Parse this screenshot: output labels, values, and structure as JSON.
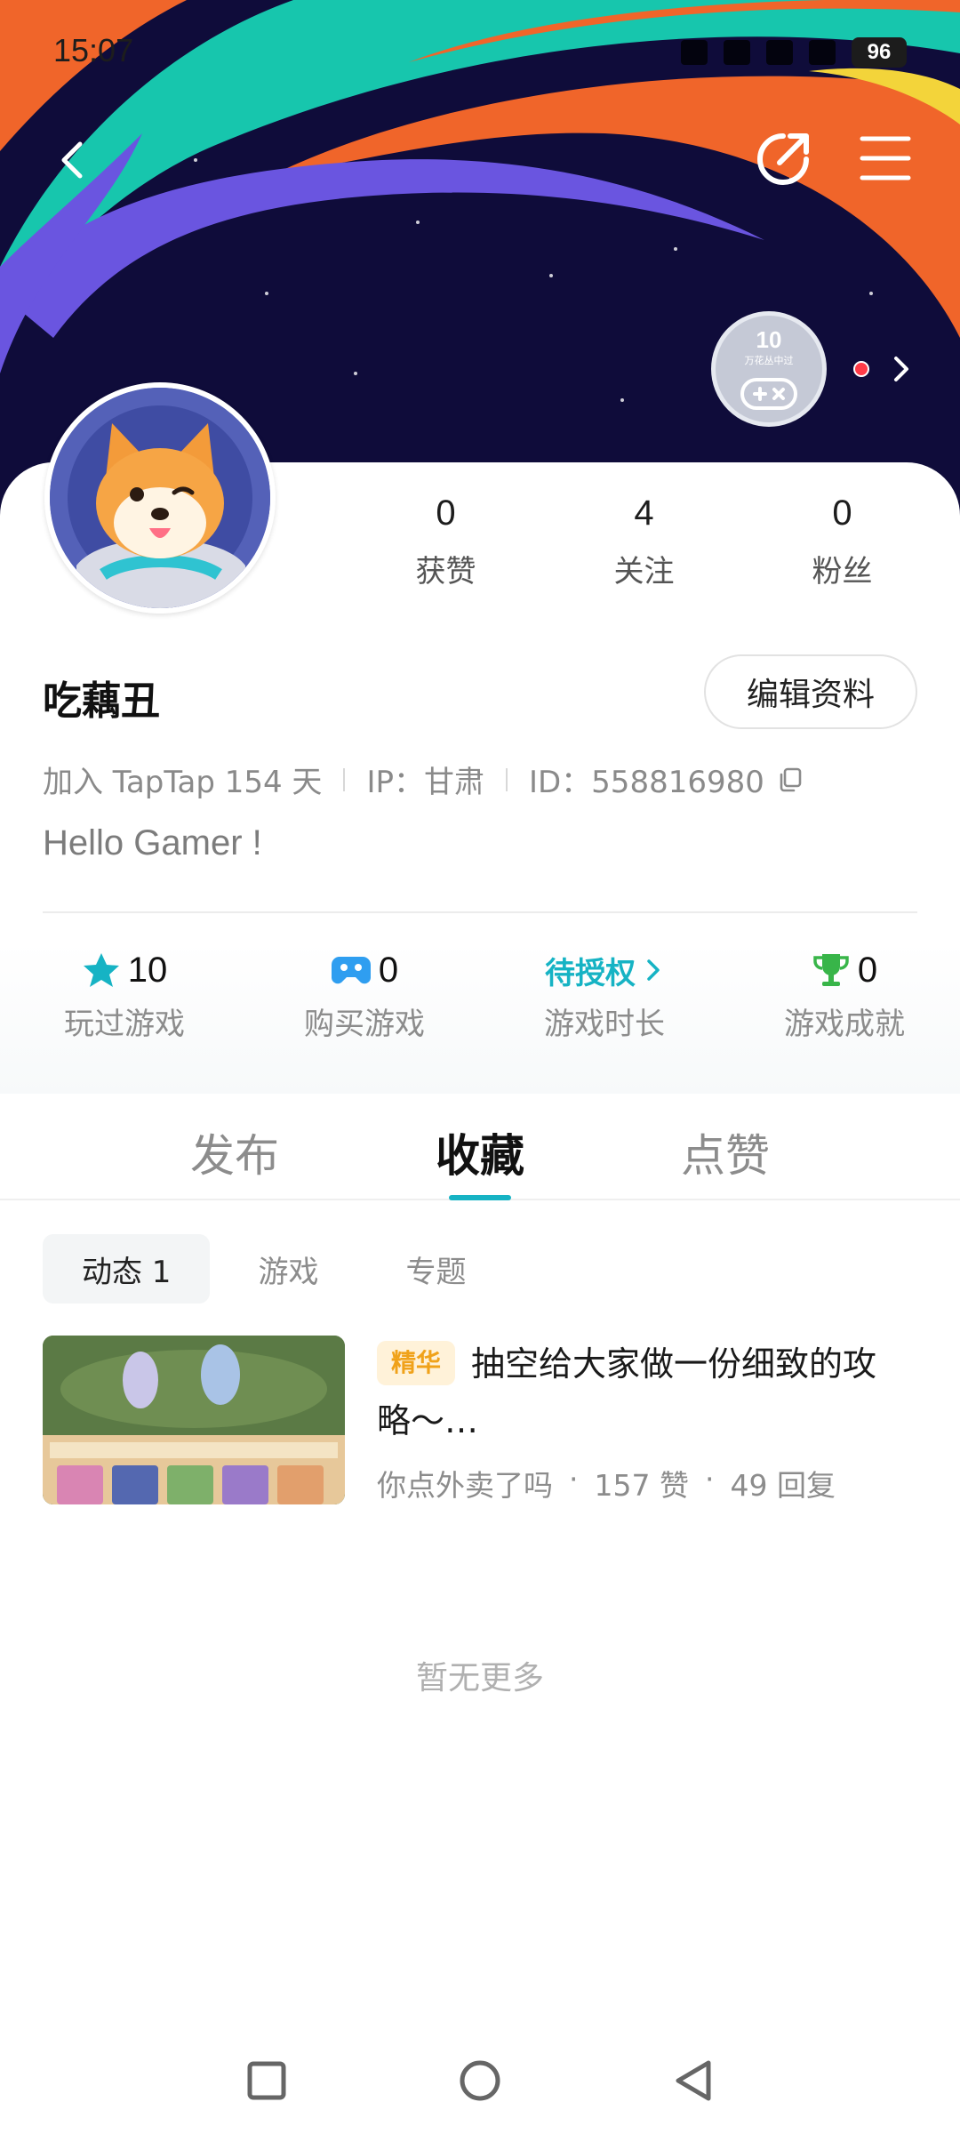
{
  "status": {
    "time": "15:07",
    "battery": "96"
  },
  "badge": {
    "count": "10",
    "subtitle": "万花丛中过"
  },
  "profile": {
    "username": "吃藕丑",
    "edit_label": "编辑资料",
    "join_text": "加入 TapTap 154 天",
    "ip_text": "IP：甘肃",
    "id_text": "ID：558816980",
    "bio": "Hello Gamer !"
  },
  "stats": [
    {
      "value": "0",
      "label": "获赞"
    },
    {
      "value": "4",
      "label": "关注"
    },
    {
      "value": "0",
      "label": "粉丝"
    }
  ],
  "games": {
    "played": {
      "value": "10",
      "label": "玩过游戏"
    },
    "bought": {
      "value": "0",
      "label": "购买游戏"
    },
    "time": {
      "value": "待授权",
      "label": "游戏时长"
    },
    "achievements": {
      "value": "0",
      "label": "游戏成就"
    }
  },
  "tabs": [
    "发布",
    "收藏",
    "点赞"
  ],
  "subtabs": [
    "动态 1",
    "游戏",
    "专题"
  ],
  "post": {
    "tag": "精华",
    "title": "抽空给大家做一份细致的攻略～…",
    "author": "你点外卖了吗",
    "likes": "157 赞",
    "replies": "49 回复",
    "dot": "·"
  },
  "no_more": "暂无更多",
  "colors": {
    "accent": "#16b3c4",
    "tag_text": "#f0a21a",
    "banner_bg": "#0f0c3a"
  }
}
